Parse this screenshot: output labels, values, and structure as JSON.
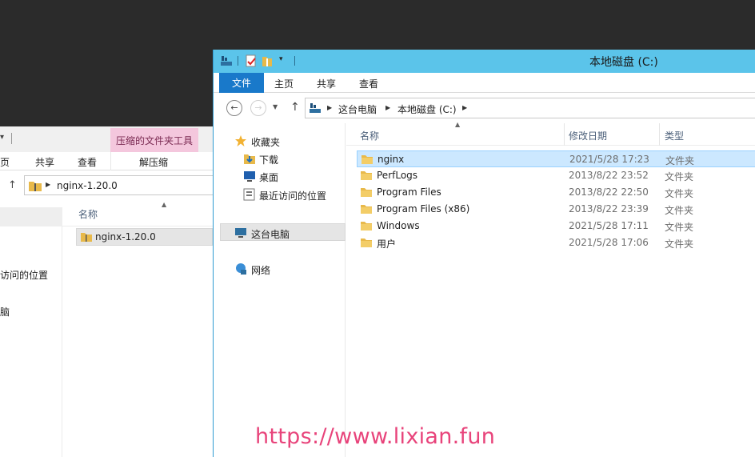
{
  "back_window": {
    "quick_access_arrow": "▾",
    "context_tab": "压缩的文件夹工具",
    "ribbon_tabs": [
      "页",
      "共享",
      "查看"
    ],
    "context_action": "解压缩",
    "address_crumb": "nginx-1.20.0",
    "nav_items": [
      "访问的位置",
      "脑"
    ],
    "list_header_name": "名称",
    "files": [
      {
        "name": "nginx-1.20.0"
      }
    ]
  },
  "front_window": {
    "title": "本地磁盘 (C:)",
    "ribbon_tabs": {
      "file": "文件",
      "home": "主页",
      "share": "共享",
      "view": "查看"
    },
    "address_crumbs": [
      "这台电脑",
      "本地磁盘 (C:)"
    ],
    "nav_items": {
      "favorites": "收藏夹",
      "downloads": "下载",
      "desktop": "桌面",
      "recent": "最近访问的位置",
      "this_pc": "这台电脑",
      "network": "网络"
    },
    "columns": {
      "name": "名称",
      "modified": "修改日期",
      "type": "类型"
    },
    "files": [
      {
        "name": "nginx",
        "modified": "2021/5/28 17:23",
        "type": "文件夹",
        "selected": true
      },
      {
        "name": "PerfLogs",
        "modified": "2013/8/22 23:52",
        "type": "文件夹",
        "selected": false
      },
      {
        "name": "Program Files",
        "modified": "2013/8/22 22:50",
        "type": "文件夹",
        "selected": false
      },
      {
        "name": "Program Files (x86)",
        "modified": "2013/8/22 23:39",
        "type": "文件夹",
        "selected": false
      },
      {
        "name": "Windows",
        "modified": "2021/5/28 17:11",
        "type": "文件夹",
        "selected": false
      },
      {
        "name": "用户",
        "modified": "2021/5/28 17:06",
        "type": "文件夹",
        "selected": false
      }
    ]
  },
  "watermark": "https://www.lixian.fun",
  "colors": {
    "title_bar": "#5bc4ea",
    "file_tab": "#1979ca",
    "context_tab": "#f4c7dd",
    "selection": "#cce8ff",
    "watermark": "#e8447b",
    "folder": "#e8b94a"
  }
}
